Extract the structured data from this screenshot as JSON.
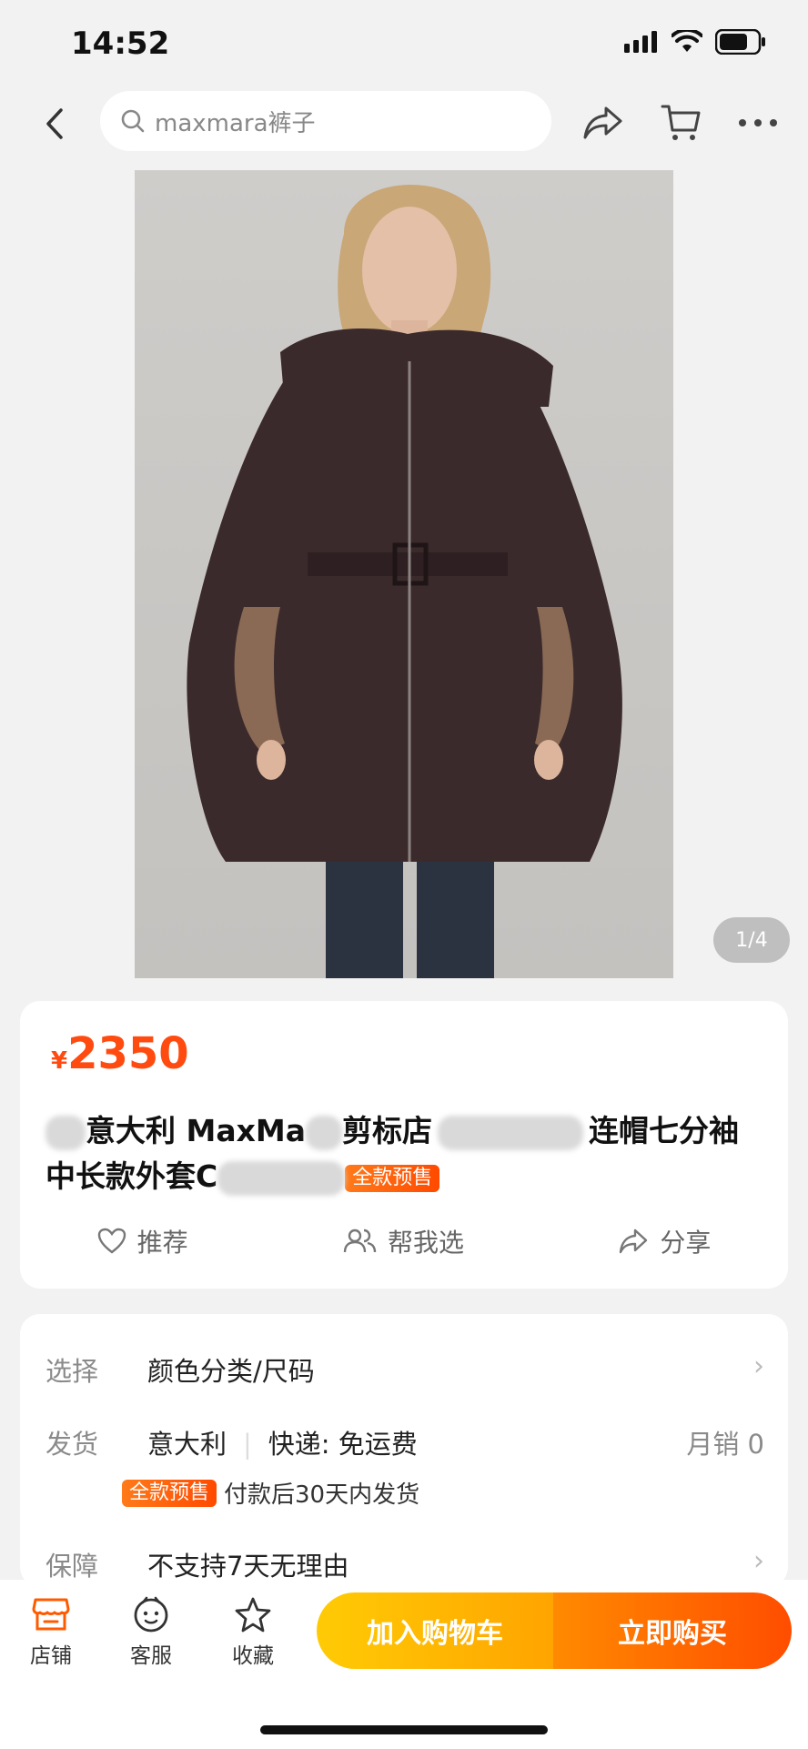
{
  "status_bar": {
    "time": "14:52"
  },
  "nav": {
    "search_text": "maxmara裤子"
  },
  "gallery": {
    "page_indicator": "1/4"
  },
  "product": {
    "currency": "¥",
    "price": "2350",
    "title_part1": "意大利 MaxMa",
    "title_part2": "剪标店",
    "title_part3": "连帽七分袖",
    "title_part4": "中长款外套C",
    "presale_tag": "全款预售"
  },
  "actions": {
    "recommend": "推荐",
    "help_choose": "帮我选",
    "share": "分享"
  },
  "info": {
    "select_label": "选择",
    "select_value": "颜色分类/尺码",
    "ship_label": "发货",
    "ship_origin": "意大利",
    "ship_method": "快递: 免运费",
    "monthly_sales": "月销  0",
    "presale_tag": "全款预售",
    "ship_note": "付款后30天内发货",
    "guarantee_label": "保障",
    "guarantee_value": "不支持7天无理由"
  },
  "bottom_bar": {
    "store": "店铺",
    "service": "客服",
    "favorite": "收藏",
    "add_to_cart": "加入购物车",
    "buy_now": "立即购买"
  },
  "colors": {
    "accent": "#ff4b10",
    "cart_yellow": "#ffb300",
    "buy_orange": "#ff5a00"
  }
}
